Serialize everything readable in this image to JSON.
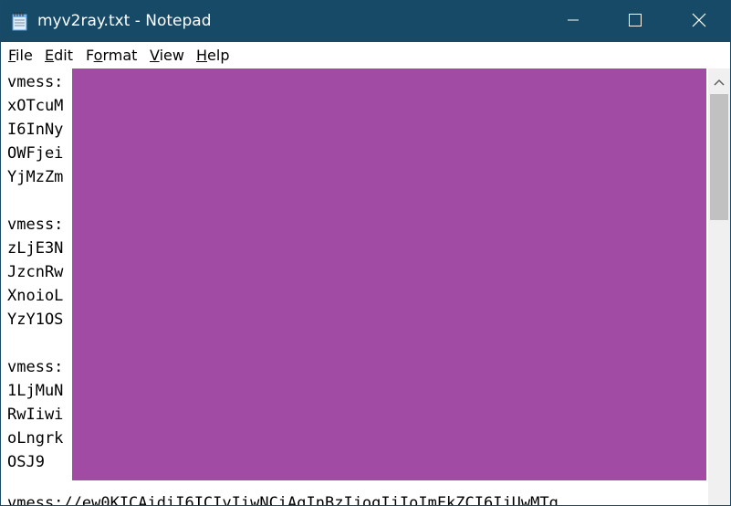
{
  "window": {
    "title": "myv2ray.txt - Notepad",
    "icon": "notepad-icon"
  },
  "controls": {
    "minimize_icon": "minimize-icon",
    "maximize_icon": "maximize-icon",
    "close_icon": "close-icon"
  },
  "menu": {
    "file": {
      "mnemonic": "F",
      "rest": "ile"
    },
    "edit": {
      "mnemonic": "E",
      "rest": "dit"
    },
    "format": {
      "pre": "F",
      "mnemonic": "o",
      "rest": "rmat"
    },
    "view": {
      "mnemonic": "V",
      "rest": "iew"
    },
    "help": {
      "mnemonic": "H",
      "rest": "elp"
    }
  },
  "editor": {
    "lines": [
      "vmess:",
      "xOTcuM",
      "I6InNy",
      "OWFjei",
      "YjMzZm",
      "",
      "vmess:",
      "zLjE3N",
      "JzcnRw",
      "XnoioL",
      "YzY1OS",
      "",
      "vmess:",
      "1LjMuN",
      "RwIiwi",
      "oLngrk",
      "OSJ9",
      "",
      "vmess://ew0KICAidiI6ICIyIiwNCiAgInBzIjogIjIoImFkZCI6IjUwMTg"
    ],
    "redaction_color": "#a24ba4"
  },
  "colors": {
    "titlebar": "#174a66",
    "scrollbar_track": "#f0f0f0",
    "scrollbar_thumb": "#c1c1c1"
  }
}
